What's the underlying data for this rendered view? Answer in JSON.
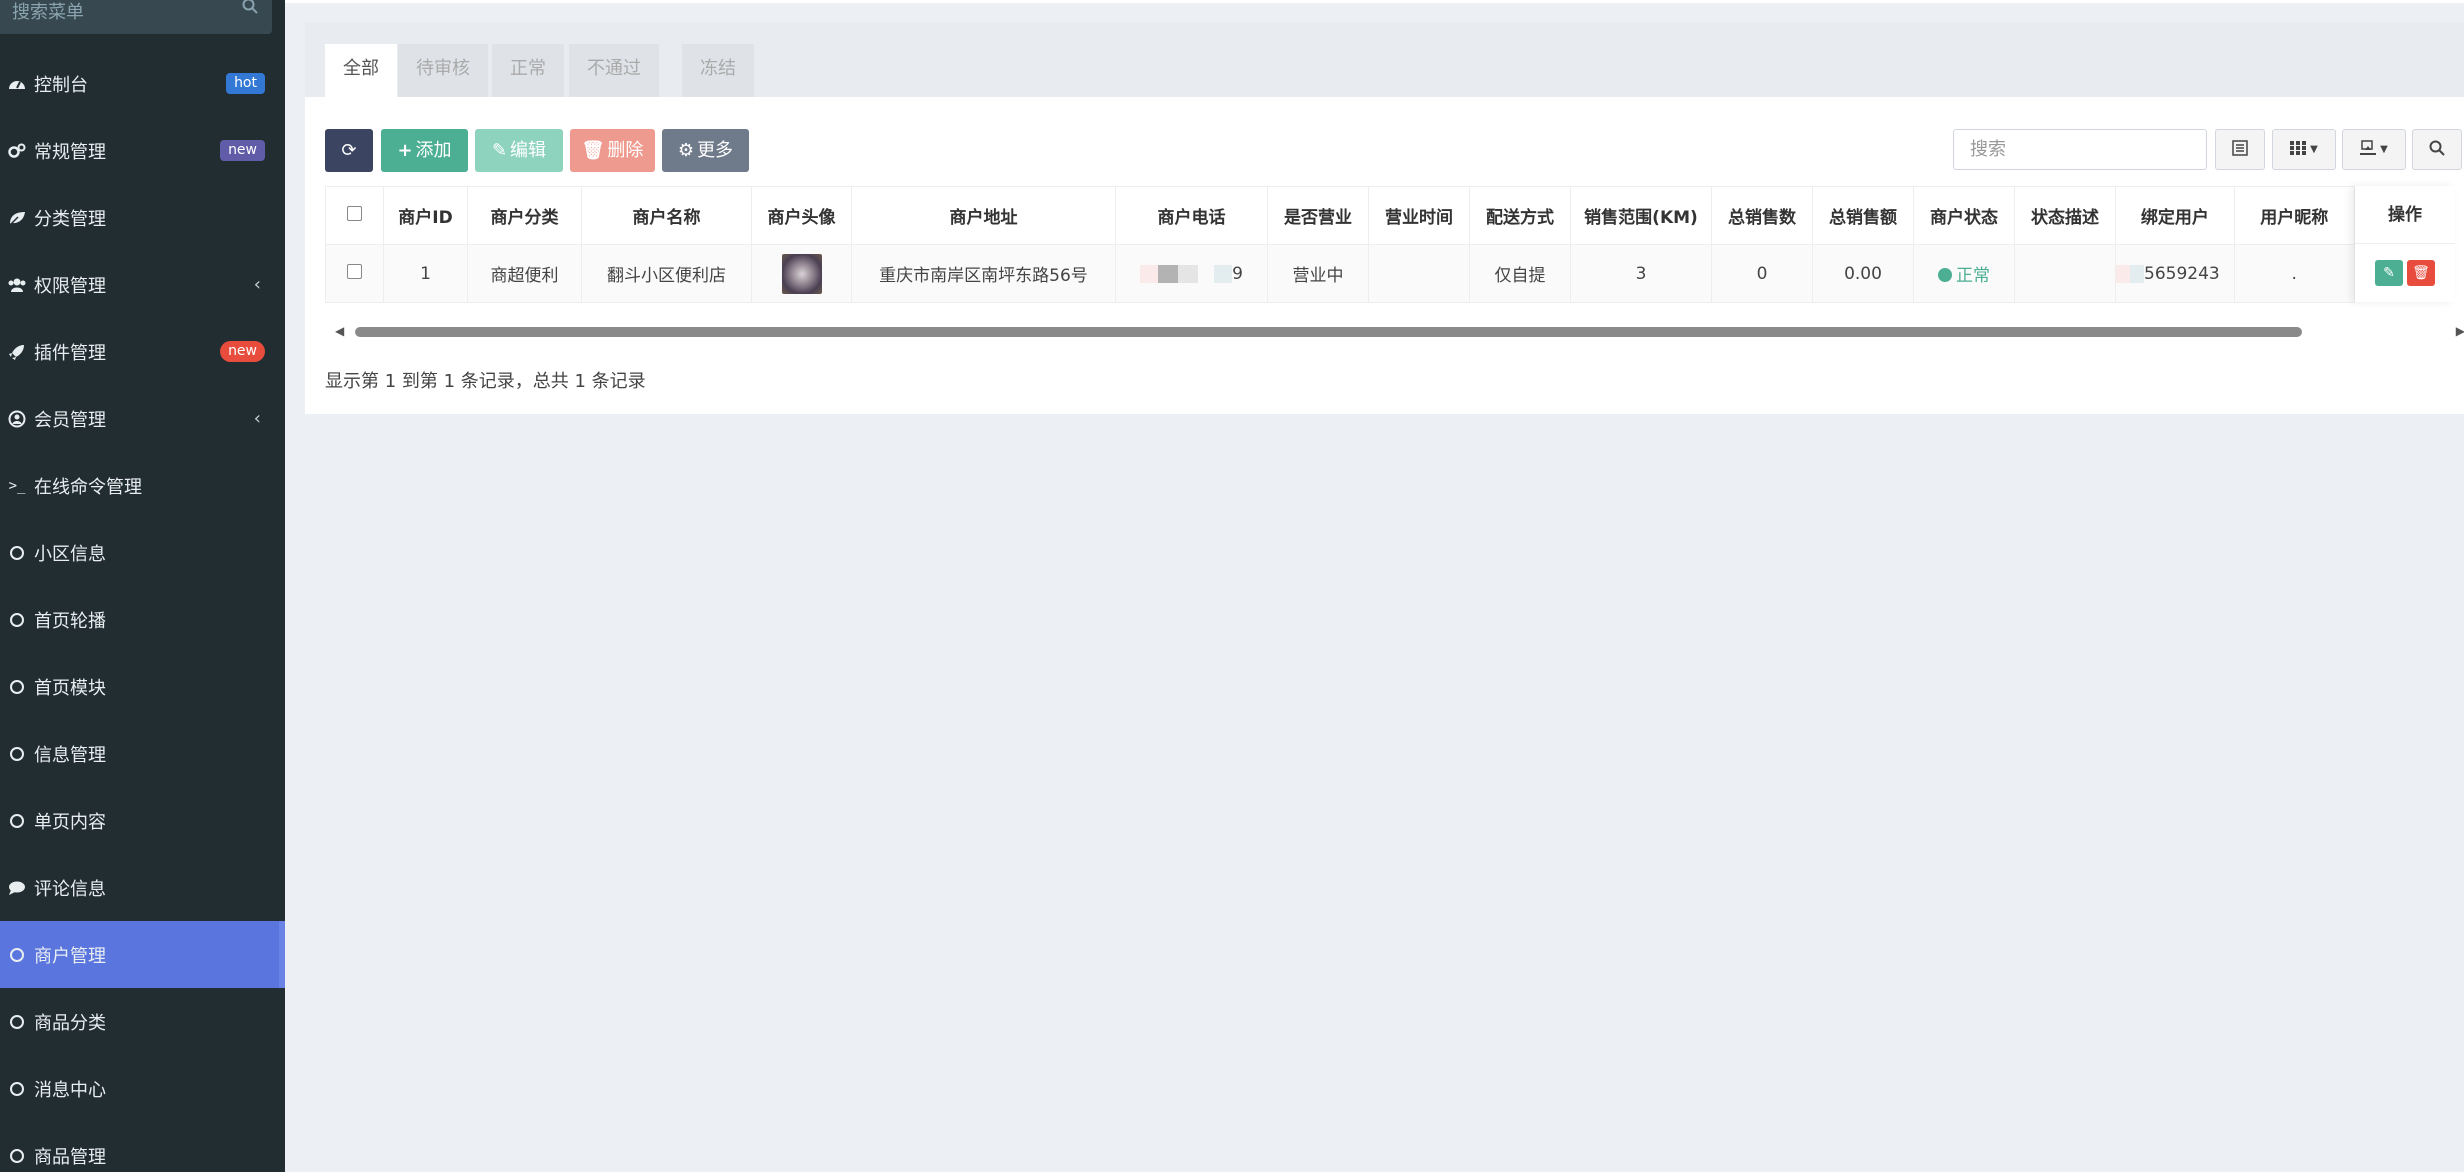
{
  "sidebar": {
    "search_placeholder": "搜索菜单",
    "items": [
      {
        "label": "控制台",
        "badge": "hot"
      },
      {
        "label": "常规管理",
        "badge": "new"
      },
      {
        "label": "分类管理"
      },
      {
        "label": "权限管理"
      },
      {
        "label": "插件管理",
        "badge": "new"
      },
      {
        "label": "会员管理"
      },
      {
        "label": "在线命令管理"
      },
      {
        "label": "小区信息"
      },
      {
        "label": "首页轮播"
      },
      {
        "label": "首页模块"
      },
      {
        "label": "信息管理"
      },
      {
        "label": "单页内容"
      },
      {
        "label": "评论信息"
      },
      {
        "label": "商户管理"
      },
      {
        "label": "商品分类"
      },
      {
        "label": "消息中心"
      },
      {
        "label": "商品管理"
      }
    ]
  },
  "tabs": [
    "全部",
    "待审核",
    "正常",
    "不通过",
    "冻结"
  ],
  "toolbar": {
    "add": "添加",
    "edit": "编辑",
    "delete": "删除",
    "more": "更多",
    "search_placeholder": "搜索"
  },
  "table": {
    "headers": [
      "商户ID",
      "商户分类",
      "商户名称",
      "商户头像",
      "商户地址",
      "商户电话",
      "是否营业",
      "营业时间",
      "配送方式",
      "销售范围(KM)",
      "总销售数",
      "总销售额",
      "商户状态",
      "状态描述",
      "绑定用户",
      "用户昵称",
      "操作"
    ],
    "row": {
      "id": "1",
      "category": "商超便利",
      "name": "翻斗小区便利店",
      "address": "重庆市南岸区南坪东路56号",
      "phone_tail": "9",
      "open": "营业中",
      "hours": "",
      "delivery": "仅自提",
      "range": "3",
      "total_count": "0",
      "total_amount": "0.00",
      "status": "正常",
      "status_desc": "",
      "bind_user_tail": "5659243",
      "nickname": "."
    }
  },
  "pagination_text": "显示第 1 到第 1 条记录，总共 1 条记录",
  "colors": {
    "sidebar_bg": "#222d32",
    "active_menu": "#5b75df",
    "success": "#4caf93",
    "danger": "#e74c3c"
  }
}
